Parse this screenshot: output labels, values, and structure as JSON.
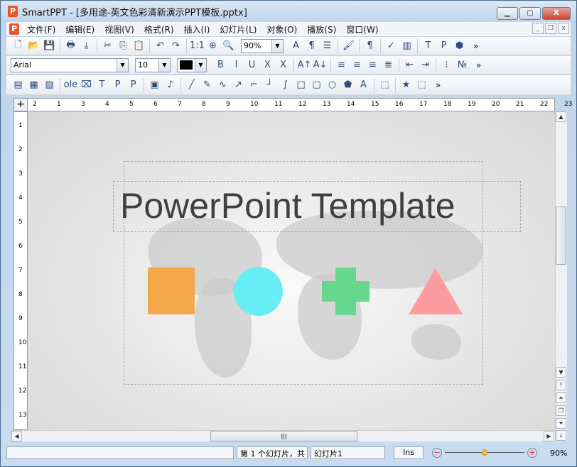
{
  "window": {
    "title": "SmartPPT - [多用途-英文色彩清新演示PPT模板.pptx]",
    "app_icon": "P",
    "buttons": [
      "▁",
      "▢",
      "X"
    ]
  },
  "menu": [
    "文件(F)",
    "编辑(E)",
    "视图(V)",
    "格式(R)",
    "插入(I)",
    "幻灯片(L)",
    "对象(O)",
    "播放(S)",
    "窗口(W)"
  ],
  "doc_buttons": [
    "_",
    "❐",
    "x"
  ],
  "toolbar1": {
    "icons": [
      "new-icon",
      "open-icon",
      "save-icon",
      "|",
      "print-icon",
      "pdf-icon",
      "|",
      "cut-icon",
      "copy-icon",
      "paste-icon",
      "|",
      "undo-icon",
      "redo-icon",
      "|",
      "actual-size-icon",
      "zoom-fit-icon",
      "zoom-icon"
    ],
    "zoom": "90%",
    "icons2": [
      "text-color-icon",
      "page-format-icon",
      "list-format-icon",
      "|",
      "format-painter-icon",
      "|",
      "paragraph-mark-icon",
      "|",
      "spellcheck-icon",
      "chart-icon",
      "|",
      "text-box-icon",
      "placeholder-icon",
      "3d-icon"
    ]
  },
  "toolbar2": {
    "font": "Arial",
    "size": "10",
    "color": "#000000",
    "icons": [
      "bold-icon",
      "italic-icon",
      "underline-icon",
      "strikethrough-icon",
      "double-strike-icon",
      "|",
      "grow-font-icon",
      "shrink-font-icon",
      "|",
      "align-left-icon",
      "align-center-icon",
      "align-right-icon",
      "justify-icon",
      "|",
      "decrease-indent-icon",
      "increase-indent-icon",
      "|",
      "bullet-list-icon",
      "numbered-list-icon"
    ]
  },
  "toolbar3": {
    "icons": [
      "text-frame-icon",
      "table-icon",
      "picture-icon",
      "|",
      "ole-icon",
      "frame-icon",
      "title-placeholder-icon",
      "placeholder-p-icon",
      "placeholder-chart-icon",
      "|",
      "video-icon",
      "audio-icon",
      "|",
      "line-icon",
      "pencil-icon",
      "curve-icon",
      "arrow-icon",
      "connector-icon",
      "elbow-connector-icon",
      "curved-connector-icon",
      "rectangle-icon",
      "rounded-rectangle-icon",
      "ellipse-icon",
      "shapes-icon",
      "wordart-icon",
      "|",
      "group-icon",
      "|",
      "star-icon",
      "ungroup-icon"
    ]
  },
  "more": "»",
  "glyphs": {
    "new-icon": "🗋",
    "open-icon": "📂",
    "save-icon": "💾",
    "print-icon": "🖶",
    "pdf-icon": "⤓",
    "cut-icon": "✂",
    "copy-icon": "⎘",
    "paste-icon": "📋",
    "undo-icon": "↶",
    "redo-icon": "↷",
    "actual-size-icon": "1:1",
    "zoom-fit-icon": "⊕",
    "zoom-icon": "🔍",
    "text-color-icon": "A",
    "page-format-icon": "¶",
    "list-format-icon": "☰",
    "format-painter-icon": "🖌",
    "paragraph-mark-icon": "¶",
    "spellcheck-icon": "✓",
    "chart-icon": "▥",
    "text-box-icon": "T",
    "placeholder-icon": "P",
    "3d-icon": "⬢",
    "bold-icon": "B",
    "italic-icon": "I",
    "underline-icon": "U",
    "strikethrough-icon": "X",
    "double-strike-icon": "X",
    "grow-font-icon": "A↑",
    "shrink-font-icon": "A↓",
    "align-left-icon": "≡",
    "align-center-icon": "≡",
    "align-right-icon": "≡",
    "justify-icon": "≣",
    "decrease-indent-icon": "⇤",
    "increase-indent-icon": "⇥",
    "bullet-list-icon": "⁝",
    "numbered-list-icon": "№",
    "text-frame-icon": "▤",
    "table-icon": "▦",
    "picture-icon": "▨",
    "ole-icon": "ole",
    "frame-icon": "⌧",
    "title-placeholder-icon": "T",
    "placeholder-p-icon": "P",
    "placeholder-chart-icon": "P",
    "video-icon": "▣",
    "audio-icon": "♪",
    "line-icon": "╱",
    "pencil-icon": "✎",
    "curve-icon": "∿",
    "arrow-icon": "↗",
    "connector-icon": "⌐",
    "elbow-connector-icon": "┘",
    "curved-connector-icon": "∫",
    "rectangle-icon": "□",
    "rounded-rectangle-icon": "▢",
    "ellipse-icon": "○",
    "shapes-icon": "⬟",
    "wordart-icon": "A",
    "group-icon": "⬚",
    "star-icon": "★",
    "ungroup-icon": "⬚"
  },
  "ruler_top": [
    "2",
    "1",
    "3",
    "4",
    "5",
    "6",
    "7",
    "8",
    "9",
    "10",
    "11",
    "12",
    "13",
    "14",
    "15",
    "16",
    "17",
    "18",
    "19",
    "20",
    "21",
    "22",
    "23"
  ],
  "ruler_left": [
    "1",
    "2",
    "3",
    "4",
    "5",
    "6",
    "7",
    "8",
    "9",
    "10",
    "11",
    "12",
    "13"
  ],
  "slide": {
    "title": "PowerPoint Template",
    "colors": {
      "square": "#f4a84a",
      "circle": "#67eef5",
      "cross": "#67d68f",
      "triangle": "#fc9ba0"
    }
  },
  "status": {
    "slide_info": "第 1 个幻灯片，共",
    "slide_name": "幻灯片1",
    "mode": "Ins",
    "zoom": "90%",
    "zoom_fraction": 0.5
  }
}
